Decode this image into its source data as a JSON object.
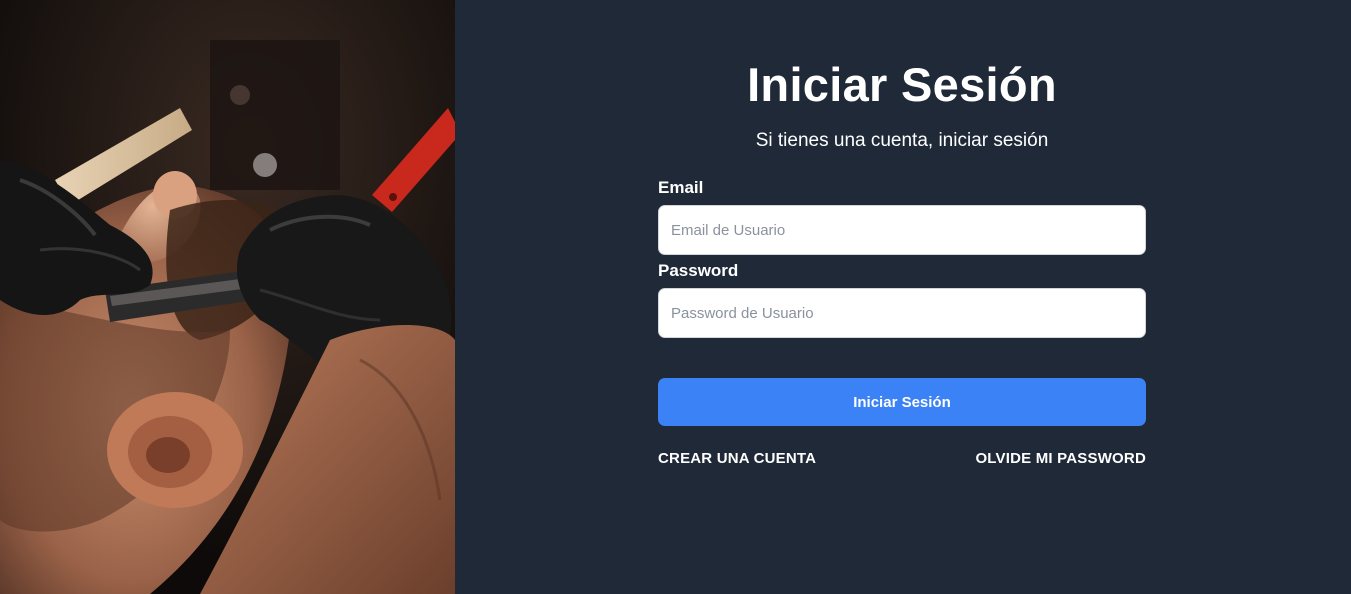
{
  "form": {
    "title": "Iniciar Sesión",
    "subtitle": "Si tienes una cuenta, iniciar sesión",
    "email_label": "Email",
    "email_placeholder": "Email de Usuario",
    "email_value": "",
    "password_label": "Password",
    "password_placeholder": "Password de Usuario",
    "password_value": "",
    "submit_label": "Iniciar Sesión"
  },
  "links": {
    "create_account": "CREAR UNA CUENTA",
    "forgot_password": "OLVIDE MI PASSWORD"
  },
  "colors": {
    "panel_background": "#1f2937",
    "button_background": "#3b82f6",
    "text": "#ffffff"
  },
  "hero": {
    "image": "barber-shaving-photo"
  }
}
